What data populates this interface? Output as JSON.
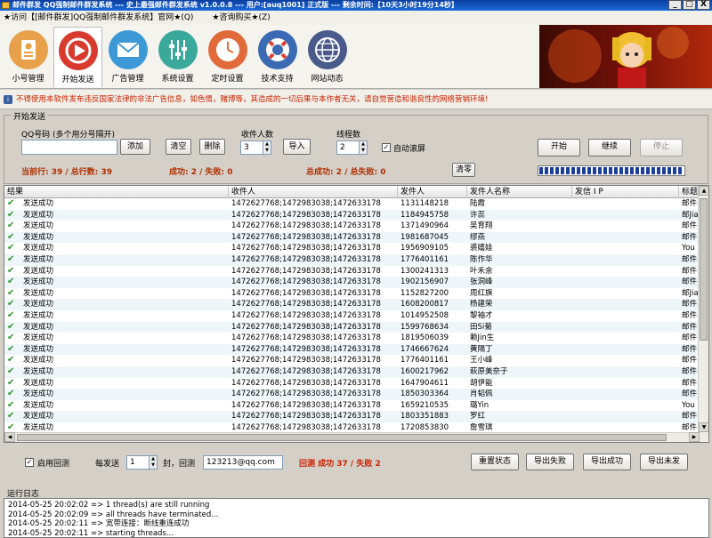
{
  "window": {
    "title": "邮件群发 QQ强制邮件群发系统 --- 史上最强邮件群发系统 v1.0.0.8 --- 用户:[auq1001] 正式版 --- 剩余时间:【10天3小时19分14秒】",
    "minimize": "_",
    "maximize": "□",
    "close": "X"
  },
  "menu": {
    "items": [
      "★访问【[邮件群发]QQ强制邮件群发系统】官网★(Q)",
      "★咨询购买★(Z)"
    ]
  },
  "toolbar": {
    "items": [
      {
        "label": "小号管理",
        "icon": "id-card-icon",
        "color": "#e8a14a"
      },
      {
        "label": "开始发送",
        "icon": "play-icon",
        "color": "#d83a2e"
      },
      {
        "label": "广告管理",
        "icon": "mail-icon",
        "color": "#3d98d6"
      },
      {
        "label": "系统设置",
        "icon": "sliders-icon",
        "color": "#3aa89a"
      },
      {
        "label": "定时设置",
        "icon": "clock-icon",
        "color": "#e06a3a"
      },
      {
        "label": "技术支持",
        "icon": "lifebuoy-icon",
        "color": "#3a6ab4"
      },
      {
        "label": "网站动态",
        "icon": "globe-icon",
        "color": "#4a5a8a"
      }
    ]
  },
  "warning": "不得使用本软件发布违反国家法律的非法广告信息，如色情，赌博等，其造成的一切后果与本作者无关，请自觉营造和谐良性的网络营销环境!",
  "send_panel": {
    "group_title": "开始发送",
    "qq_label": "QQ号码 (多个用分号隔开)",
    "qq_value": "",
    "add_btn": "添加",
    "clear_btn": "清空",
    "delete_btn": "删除",
    "recipients_label": "收件人数",
    "recipients_value": "3",
    "import_btn": "导入",
    "threads_label": "线程数",
    "threads_value": "2",
    "autoscroll_label": "自动滚屏",
    "autoscroll_checked": true,
    "start_btn": "开始",
    "continue_btn": "继续",
    "stop_btn": "停止",
    "current_stat": "当前行: 39 / 总行数: 39",
    "success_stat": "成功: 2 / 失败: 0",
    "total_stat": "总成功: 2 / 总失败: 0",
    "reset_btn": "清零"
  },
  "table": {
    "columns": [
      "结果",
      "收件人",
      "发件人",
      "发件人名称",
      "发信 I P",
      "标题"
    ],
    "rows": [
      {
        "result": "发送成功",
        "to": "1472627768;1472983038;1472633178",
        "from": "1131148218",
        "name": "陆霞",
        "ip": "",
        "subject": "邮件"
      },
      {
        "result": "发送成功",
        "to": "1472627768;1472983038;1472633178",
        "from": "1184945758",
        "name": "许蕊",
        "ip": "",
        "subject": "邮Jia"
      },
      {
        "result": "发送成功",
        "to": "1472627768;1472983038;1472633178",
        "from": "1371490964",
        "name": "吴育翔",
        "ip": "",
        "subject": "邮件"
      },
      {
        "result": "发送成功",
        "to": "1472627768;1472983038;1472633178",
        "from": "1981687045",
        "name": "缪燕",
        "ip": "",
        "subject": "邮件"
      },
      {
        "result": "发送成功",
        "to": "1472627768;1472983038;1472633178",
        "from": "1956909105",
        "name": "裘嬉娃",
        "ip": "",
        "subject": "You"
      },
      {
        "result": "发送成功",
        "to": "1472627768;1472983038;1472633178",
        "from": "1776401161",
        "name": "陈作华",
        "ip": "",
        "subject": "邮件"
      },
      {
        "result": "发送成功",
        "to": "1472627768;1472983038;1472633178",
        "from": "1300241313",
        "name": "叶禾余",
        "ip": "",
        "subject": "邮件"
      },
      {
        "result": "发送成功",
        "to": "1472627768;1472983038;1472633178",
        "from": "1902156907",
        "name": "张洞峰",
        "ip": "",
        "subject": "邮件"
      },
      {
        "result": "发送成功",
        "to": "1472627768;1472983038;1472633178",
        "from": "1152827200",
        "name": "周红旗",
        "ip": "",
        "subject": "邮Jia"
      },
      {
        "result": "发送成功",
        "to": "1472627768;1472983038;1472633178",
        "from": "1608200817",
        "name": "杨建荣",
        "ip": "",
        "subject": "邮件"
      },
      {
        "result": "发送成功",
        "to": "1472627768;1472983038;1472633178",
        "from": "1014952508",
        "name": "黎袖才",
        "ip": "",
        "subject": "邮件"
      },
      {
        "result": "发送成功",
        "to": "1472627768;1472983038;1472633178",
        "from": "1599768634",
        "name": "田Si菊",
        "ip": "",
        "subject": "邮件"
      },
      {
        "result": "发送成功",
        "to": "1472627768;1472983038;1472633178",
        "from": "1819506039",
        "name": "赖Jin生",
        "ip": "",
        "subject": "邮件"
      },
      {
        "result": "发送成功",
        "to": "1472627768;1472983038;1472633178",
        "from": "1746667624",
        "name": "黄隔丁",
        "ip": "",
        "subject": "邮件"
      },
      {
        "result": "发送成功",
        "to": "1472627768;1472983038;1472633178",
        "from": "1776401161",
        "name": "王小峰",
        "ip": "",
        "subject": "邮件"
      },
      {
        "result": "发送成功",
        "to": "1472627768;1472983038;1472633178",
        "from": "1600217962",
        "name": "萩原美奈子",
        "ip": "",
        "subject": "邮件"
      },
      {
        "result": "发送成功",
        "to": "1472627768;1472983038;1472633178",
        "from": "1647904611",
        "name": "胡伊能",
        "ip": "",
        "subject": "邮件"
      },
      {
        "result": "发送成功",
        "to": "1472627768;1472983038;1472633178",
        "from": "1850303364",
        "name": "肖韬佩",
        "ip": "",
        "subject": "邮件"
      },
      {
        "result": "发送成功",
        "to": "1472627768;1472983038;1472633178",
        "from": "1659210535",
        "name": "璐Yin",
        "ip": "",
        "subject": "You"
      },
      {
        "result": "发送成功",
        "to": "1472627768;1472983038;1472633178",
        "from": "1803351883",
        "name": "罗红",
        "ip": "",
        "subject": "邮件"
      },
      {
        "result": "发送成功",
        "to": "1472627768;1472983038;1472633178",
        "from": "1720853830",
        "name": "詹雪琪",
        "ip": "",
        "subject": "邮件"
      }
    ]
  },
  "bottom": {
    "reply_label": "启用回测",
    "reply_checked": true,
    "per_send_label": "每发送",
    "per_send_value": "1",
    "unit_label": "封，回测",
    "reply_email": "123213@qq.com",
    "reply_stat": "回测 成功 37 / 失败 2",
    "reset_status_btn": "重置状态",
    "export_fail_btn": "导出失败",
    "export_success_btn": "导出成功",
    "export_unsent_btn": "导出未发"
  },
  "log": {
    "title": "运行日志",
    "lines": [
      "2014-05-25 20:02:02 => 1 thread(s) are still running",
      "2014-05-25 20:02:09 => all threads have terminated...",
      "2014-05-25 20:02:11 => 宽带连接：断线重连成功",
      "2014-05-25 20:02:11 => starting threads..."
    ]
  }
}
